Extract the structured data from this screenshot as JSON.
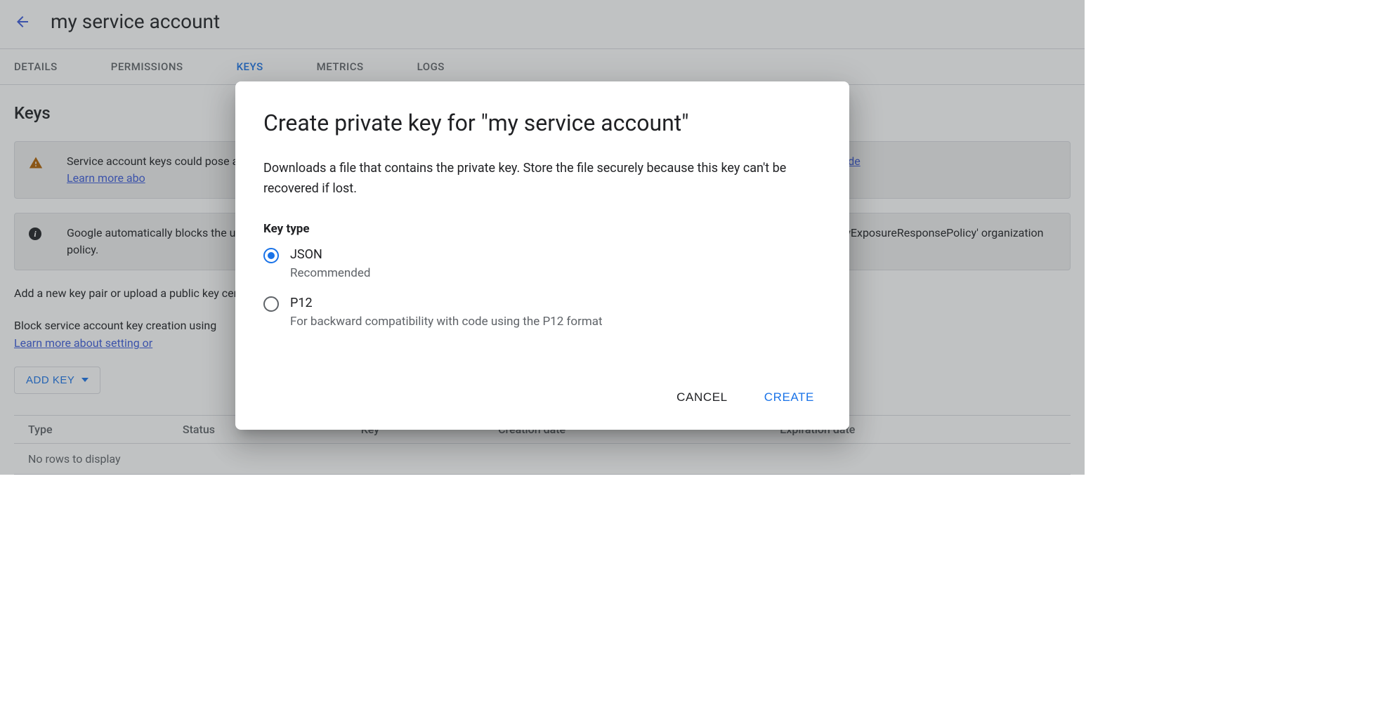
{
  "header": {
    "title": "my service account"
  },
  "tabs": {
    "items": [
      "DETAILS",
      "PERMISSIONS",
      "KEYS",
      "METRICS",
      "LOGS"
    ],
    "active_index": 2
  },
  "keys_section": {
    "heading": "Keys",
    "warning": {
      "text_before_link1": "Service account keys could pose a security risk if compromised. We recommend you avoid downloading service account keys and instead use the ",
      "link1": "Workload Ide",
      "line2_prefix": "",
      "learn_more": "Learn more abo"
    },
    "info": {
      "text": "Google automatically blocks the use of certain keys if they are found in public repositories. You can change this behavior by using the 'iam.serviceAccountKeyExposureResponsePolicy' organization policy."
    },
    "para1": "Add a new key pair or upload a public key certificate from an existing key pair.",
    "para2_prefix": "Block service account key creation using ",
    "para2_link": "Learn more about setting or",
    "add_key_label": "ADD KEY",
    "table": {
      "columns": [
        "Type",
        "Status",
        "Key",
        "Creation date",
        "Expiration date"
      ],
      "empty": "No rows to display"
    }
  },
  "dialog": {
    "title": "Create private key for \"my service account\"",
    "description": "Downloads a file that contains the private key. Store the file securely because this key can't be recovered if lost.",
    "group_label": "Key type",
    "options": [
      {
        "label": "JSON",
        "sub": "Recommended",
        "checked": true
      },
      {
        "label": "P12",
        "sub": "For backward compatibility with code using the P12 format",
        "checked": false
      }
    ],
    "cancel": "CANCEL",
    "create": "CREATE"
  }
}
